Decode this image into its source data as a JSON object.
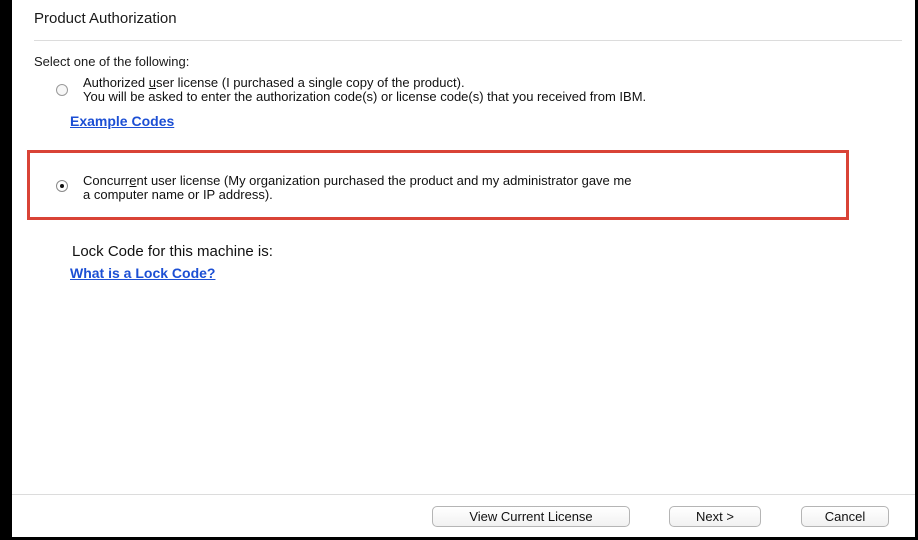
{
  "window": {
    "title": "Product Authorization",
    "prompt": "Select one of the following:"
  },
  "options": {
    "authorized": {
      "line1_pre": "Authorized ",
      "line1_u": "u",
      "line1_post": "ser license (I purchased a single copy of the product).",
      "line2": "You will be asked to enter the authorization code(s) or license code(s) that you received from IBM.",
      "selected": false
    },
    "example_codes": "Example Codes",
    "concurrent": {
      "line1_pre": "Concurr",
      "line1_u": "e",
      "line1_post": "nt user license (My organization purchased the product and my administrator gave me",
      "line2": "a computer name or IP address).",
      "selected": true
    }
  },
  "lock": {
    "label": "Lock Code for this machine is:",
    "help_link": "What is a Lock Code?"
  },
  "buttons": {
    "view_license": "View Current License",
    "next": "Next >",
    "cancel": "Cancel"
  },
  "colors": {
    "highlight": "#d94336",
    "link": "#1c4fd4"
  }
}
